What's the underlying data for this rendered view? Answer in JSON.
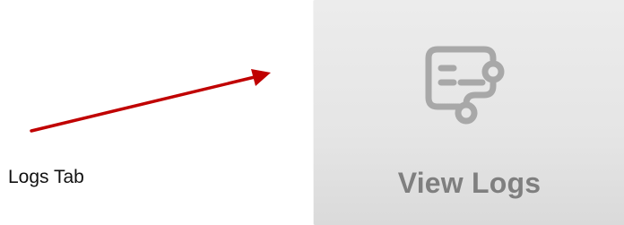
{
  "annotation": {
    "label": "Logs Tab",
    "arrow_color": "#c00000"
  },
  "tile": {
    "icon": "view-logs-icon",
    "label": "View Logs",
    "icon_color": "#a8a8a8",
    "label_color": "#7f7f7f"
  }
}
